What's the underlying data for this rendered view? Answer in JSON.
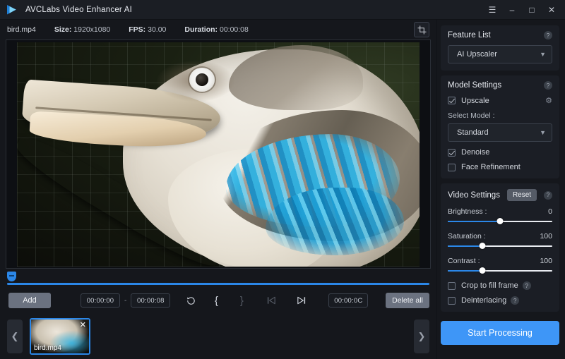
{
  "window": {
    "title": "AVCLabs Video Enhancer AI",
    "logo_icon": "play-triangle-logo",
    "controls": [
      {
        "name": "menu",
        "icon": "hamburger-menu-icon",
        "glyph": "☰"
      },
      {
        "name": "minimize",
        "icon": "minimize-icon",
        "glyph": "–"
      },
      {
        "name": "maximize",
        "icon": "maximize-icon",
        "glyph": "□"
      },
      {
        "name": "close",
        "icon": "close-icon",
        "glyph": "✕"
      }
    ]
  },
  "media_info": {
    "filename": "bird.mp4",
    "size_label": "Size:",
    "size_value": "1920x1080",
    "fps_label": "FPS:",
    "fps_value": "30.00",
    "duration_label": "Duration:",
    "duration_value": "00:00:08",
    "crop_tool_icon": "crop-icon"
  },
  "preview": {
    "content_description": "blue-winged kookaburra perched on a branch"
  },
  "transport": {
    "add_label": "Add",
    "start_time": "00:00:00",
    "range_separator": "-",
    "end_time": "00:00:08",
    "reset_playback_icon": "rotate-ccw-icon",
    "mark_in_label": "{",
    "mark_out_label": "}",
    "prev_frame_icon": "skip-previous-icon",
    "next_frame_icon": "skip-next-icon",
    "current_time": "00:00:0C",
    "delete_all_label": "Delete all"
  },
  "filmstrip": {
    "prev_icon": "chevron-left-icon",
    "next_icon": "chevron-right-icon",
    "items": [
      {
        "label": "bird.mp4",
        "remove_icon": "close-icon",
        "selected": true
      }
    ]
  },
  "feature_list": {
    "title": "Feature List",
    "help_icon": "question-mark-icon",
    "selected": "AI Upscaler",
    "chevron_icon": "chevron-down-icon"
  },
  "model_settings": {
    "title": "Model Settings",
    "help_icon": "question-mark-icon",
    "upscale": {
      "label": "Upscale",
      "checked": true,
      "gear_icon": "gear-icon"
    },
    "select_model_label": "Select Model :",
    "selected_model": "Standard",
    "chevron_icon": "chevron-down-icon",
    "denoise": {
      "label": "Denoise",
      "checked": true
    },
    "face_refinement": {
      "label": "Face Refinement",
      "checked": false
    }
  },
  "video_settings": {
    "title": "Video Settings",
    "reset_label": "Reset",
    "help_icon": "question-mark-icon",
    "sliders": [
      {
        "label": "Brightness :",
        "value": "0",
        "percent": 50
      },
      {
        "label": "Saturation :",
        "value": "100",
        "percent": 33
      },
      {
        "label": "Contrast :",
        "value": "100",
        "percent": 33
      }
    ],
    "checkboxes": [
      {
        "label": "Crop to fill frame",
        "checked": false,
        "help_icon": "question-mark-icon"
      },
      {
        "label": "Deinterlacing",
        "checked": false,
        "help_icon": "question-mark-icon"
      }
    ]
  },
  "actions": {
    "start_processing_label": "Start Processing"
  },
  "colors": {
    "accent_blue": "#3e96f7",
    "timeline_blue": "#2b87e8",
    "panel_bg": "#1b1e25",
    "app_bg": "#15171c",
    "button_gray": "#6b7280"
  }
}
